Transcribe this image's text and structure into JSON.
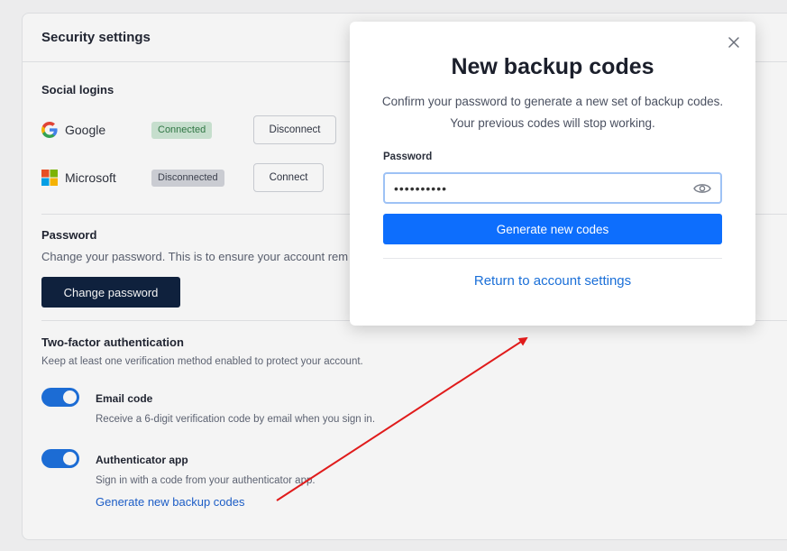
{
  "card": {
    "title": "Security settings"
  },
  "social": {
    "title": "Social logins",
    "providers": [
      {
        "name": "Google",
        "status": "Connected",
        "action": "Disconnect"
      },
      {
        "name": "Microsoft",
        "status": "Disconnected",
        "action": "Connect"
      }
    ]
  },
  "password": {
    "title": "Password",
    "description": "Change your password. This is to ensure your account rem",
    "button": "Change password"
  },
  "twofa": {
    "title": "Two-factor authentication",
    "description": "Keep at least one verification method enabled to protect your account.",
    "options": [
      {
        "label": "Email code",
        "description": "Receive a 6-digit verification code by email when you sign in.",
        "enabled": true
      },
      {
        "label": "Authenticator app",
        "description": "Sign in with a code from your authenticator app.",
        "enabled": true
      }
    ],
    "backup_link": "Generate new backup codes"
  },
  "modal": {
    "title": "New backup codes",
    "desc_line1": "Confirm your password to generate a new set of backup codes.",
    "desc_line2": "Your previous codes will stop working.",
    "password_label": "Password",
    "password_value": "••••••••••",
    "submit": "Generate new codes",
    "return_link": "Return to account settings"
  },
  "colors": {
    "primary": "#0d6efd",
    "dark_button": "#0c1f3d",
    "toggle_on": "#1a6fde",
    "annotation_arrow": "#e01b1b"
  }
}
